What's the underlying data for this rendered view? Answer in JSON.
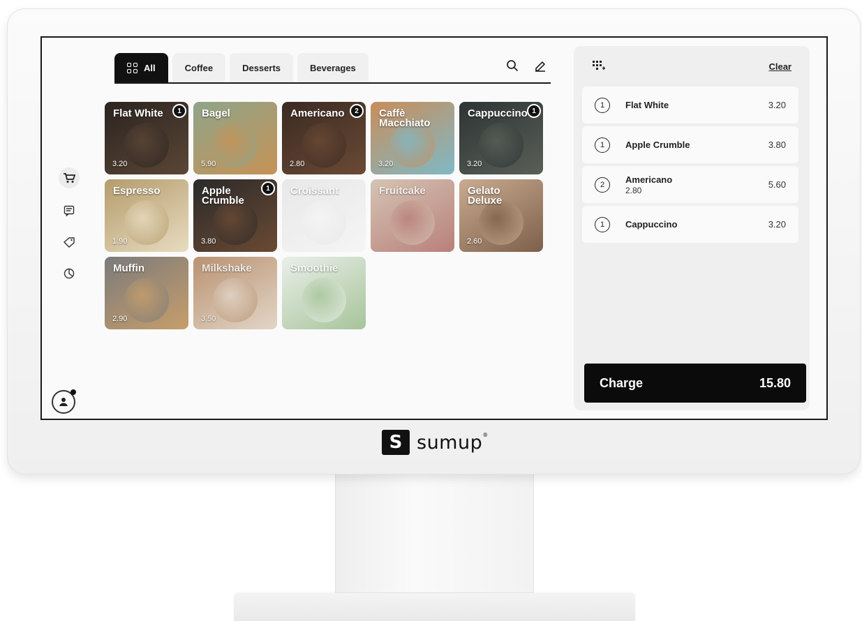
{
  "brand": {
    "name": "sumup",
    "mark": "S",
    "registered": "®"
  },
  "tabs": [
    {
      "label": "All",
      "active": true
    },
    {
      "label": "Coffee",
      "active": false
    },
    {
      "label": "Desserts",
      "active": false
    },
    {
      "label": "Beverages",
      "active": false
    }
  ],
  "toolbar": {
    "search_icon": "search-icon",
    "edit_icon": "pencil-icon"
  },
  "sidebar": {
    "items": [
      {
        "icon": "cart-icon",
        "active": true
      },
      {
        "icon": "receipt-icon",
        "active": false
      },
      {
        "icon": "tag-icon",
        "active": false
      },
      {
        "icon": "pie-chart-icon",
        "active": false
      }
    ],
    "profile_icon": "user-icon"
  },
  "products": [
    {
      "name": "Flat White",
      "price": "3.20",
      "badge": "1",
      "colors": [
        "#2b2420",
        "#5b4636"
      ]
    },
    {
      "name": "Bagel",
      "price": "5.90",
      "badge": "",
      "colors": [
        "#8fa58a",
        "#c69255"
      ]
    },
    {
      "name": "Americano",
      "price": "2.80",
      "badge": "2",
      "colors": [
        "#3b2a22",
        "#6a4a35"
      ]
    },
    {
      "name": "Caffè Macchiato",
      "price": "3.20",
      "badge": "",
      "colors": [
        "#c98d5b",
        "#7fb9c6"
      ]
    },
    {
      "name": "Cappuccino",
      "price": "3.20",
      "badge": "1",
      "colors": [
        "#2d3434",
        "#5a5f57"
      ]
    },
    {
      "name": "Espresso",
      "price": "1.90",
      "badge": "",
      "colors": [
        "#b59c6c",
        "#e7dcc0"
      ]
    },
    {
      "name": "Apple Crumble",
      "price": "3.80",
      "badge": "1",
      "colors": [
        "#2a2a2a",
        "#6b4a33"
      ]
    },
    {
      "name": "Croissant",
      "price": "",
      "badge": "",
      "colors": [
        "#e8e8e8",
        "#f5f5f5"
      ],
      "faded": true
    },
    {
      "name": "Fruitcake",
      "price": "",
      "badge": "",
      "colors": [
        "#d4c4b4",
        "#b9807a"
      ],
      "faded": true
    },
    {
      "name": "Gelato Deluxe",
      "price": "2.60",
      "badge": "",
      "colors": [
        "#c9ab90",
        "#7e5f4a"
      ]
    },
    {
      "name": "Muffin",
      "price": "2.90",
      "badge": "",
      "colors": [
        "#7b7b7b",
        "#c79e6b"
      ]
    },
    {
      "name": "Milkshake",
      "price": "3.50",
      "badge": "",
      "colors": [
        "#b99271",
        "#e2d6c8"
      ],
      "faded": true
    },
    {
      "name": "Smoothie",
      "price": "",
      "badge": "",
      "colors": [
        "#e9efe9",
        "#a7c49a"
      ],
      "faded": true
    }
  ],
  "order": {
    "clear_label": "Clear",
    "keypad_icon": "keypad-icon",
    "items": [
      {
        "qty": "1",
        "name": "Flat White",
        "sub": "",
        "amount": "3.20"
      },
      {
        "qty": "1",
        "name": "Apple Crumble",
        "sub": "",
        "amount": "3.80"
      },
      {
        "qty": "2",
        "name": "Americano",
        "sub": "2.80",
        "amount": "5.60"
      },
      {
        "qty": "1",
        "name": "Cappuccino",
        "sub": "",
        "amount": "3.20"
      }
    ],
    "charge_label": "Charge",
    "total": "15.80"
  }
}
